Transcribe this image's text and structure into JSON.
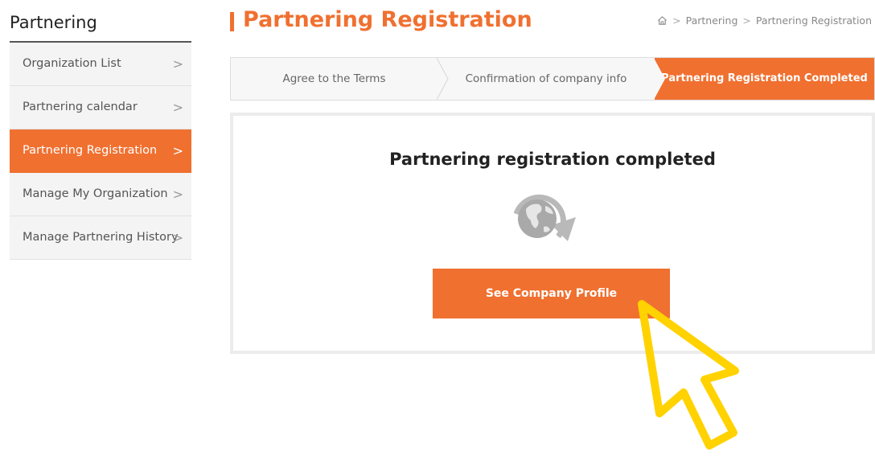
{
  "sidebar": {
    "title": "Partnering",
    "items": [
      {
        "label": "Organization List",
        "chevron": ">"
      },
      {
        "label": "Partnering calendar",
        "chevron": ">"
      },
      {
        "label": "Partnering Registration",
        "chevron": ">",
        "active": true
      },
      {
        "label": "Manage My Organization",
        "chevron": ">"
      },
      {
        "label": "Manage Partnering History",
        "chevron": ">"
      }
    ]
  },
  "header": {
    "title": "Partnering Registration",
    "breadcrumb": {
      "home_icon": "home-icon",
      "separator": ">",
      "items": [
        "Partnering",
        "Partnering Registration"
      ]
    }
  },
  "steps": [
    {
      "label": "Agree to the Terms"
    },
    {
      "label": "Confirmation of company info"
    },
    {
      "label": "Partnering Registration Completed",
      "active": true
    }
  ],
  "main": {
    "heading": "Partnering registration completed",
    "icon": "globe-refresh-icon",
    "button_label": "See Company Profile"
  },
  "colors": {
    "accent": "#f07030",
    "cursor": "#ffd200"
  }
}
